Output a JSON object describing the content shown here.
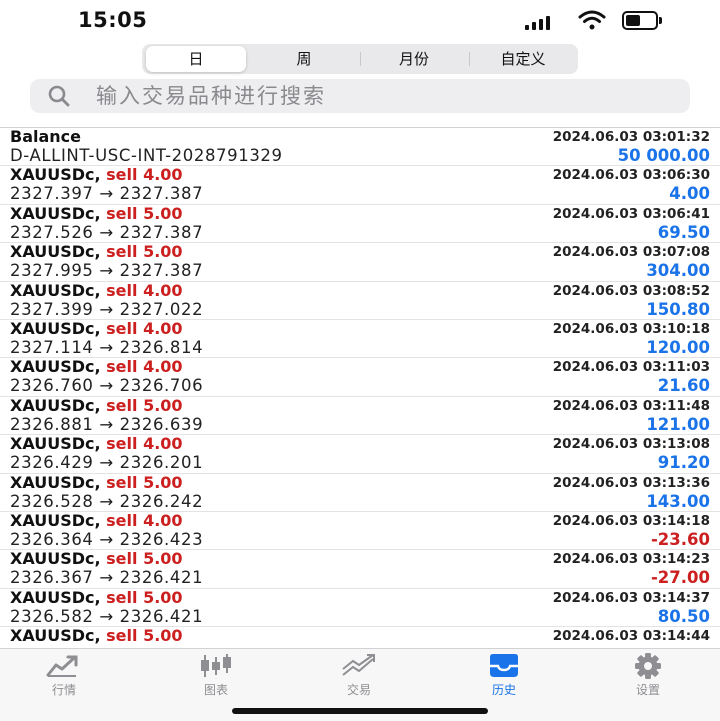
{
  "status_bar": {
    "time": "15:05"
  },
  "segments": [
    {
      "label": "日",
      "active": true
    },
    {
      "label": "周",
      "active": false
    },
    {
      "label": "月份",
      "active": false
    },
    {
      "label": "自定义",
      "active": false
    }
  ],
  "search": {
    "placeholder": "输入交易品种进行搜索"
  },
  "balance_row": {
    "title": "Balance",
    "account": "D-ALLINT-USC-INT-2028791329",
    "time": "2024.06.03 03:01:32",
    "amount": "50 000.00"
  },
  "trades": [
    {
      "symbol": "XAUUSDc,",
      "side": "sell 4.00",
      "prices": "2327.397 → 2327.387",
      "time": "2024.06.03 03:06:30",
      "profit": "4.00",
      "negative": false
    },
    {
      "symbol": "XAUUSDc,",
      "side": "sell 5.00",
      "prices": "2327.526 → 2327.387",
      "time": "2024.06.03 03:06:41",
      "profit": "69.50",
      "negative": false
    },
    {
      "symbol": "XAUUSDc,",
      "side": "sell 5.00",
      "prices": "2327.995 → 2327.387",
      "time": "2024.06.03 03:07:08",
      "profit": "304.00",
      "negative": false
    },
    {
      "symbol": "XAUUSDc,",
      "side": "sell 4.00",
      "prices": "2327.399 → 2327.022",
      "time": "2024.06.03 03:08:52",
      "profit": "150.80",
      "negative": false
    },
    {
      "symbol": "XAUUSDc,",
      "side": "sell 4.00",
      "prices": "2327.114 → 2326.814",
      "time": "2024.06.03 03:10:18",
      "profit": "120.00",
      "negative": false
    },
    {
      "symbol": "XAUUSDc,",
      "side": "sell 4.00",
      "prices": "2326.760 → 2326.706",
      "time": "2024.06.03 03:11:03",
      "profit": "21.60",
      "negative": false
    },
    {
      "symbol": "XAUUSDc,",
      "side": "sell 5.00",
      "prices": "2326.881 → 2326.639",
      "time": "2024.06.03 03:11:48",
      "profit": "121.00",
      "negative": false
    },
    {
      "symbol": "XAUUSDc,",
      "side": "sell 4.00",
      "prices": "2326.429 → 2326.201",
      "time": "2024.06.03 03:13:08",
      "profit": "91.20",
      "negative": false
    },
    {
      "symbol": "XAUUSDc,",
      "side": "sell 5.00",
      "prices": "2326.528 → 2326.242",
      "time": "2024.06.03 03:13:36",
      "profit": "143.00",
      "negative": false
    },
    {
      "symbol": "XAUUSDc,",
      "side": "sell 4.00",
      "prices": "2326.364 → 2326.423",
      "time": "2024.06.03 03:14:18",
      "profit": "-23.60",
      "negative": true
    },
    {
      "symbol": "XAUUSDc,",
      "side": "sell 5.00",
      "prices": "2326.367 → 2326.421",
      "time": "2024.06.03 03:14:23",
      "profit": "-27.00",
      "negative": true
    },
    {
      "symbol": "XAUUSDc,",
      "side": "sell 5.00",
      "prices": "2326.582 → 2326.421",
      "time": "2024.06.03 03:14:37",
      "profit": "80.50",
      "negative": false
    },
    {
      "symbol": "XAUUSDc,",
      "side": "sell 5.00",
      "prices": "",
      "time": "2024.06.03 03:14:44",
      "profit": "",
      "negative": false
    }
  ],
  "tabs": [
    {
      "label": "行情",
      "icon": "quotes-icon",
      "active": false
    },
    {
      "label": "图表",
      "icon": "candlestick-chart-icon",
      "active": false
    },
    {
      "label": "交易",
      "icon": "trade-icon",
      "active": false
    },
    {
      "label": "历史",
      "icon": "history-icon",
      "active": true
    },
    {
      "label": "设置",
      "icon": "gear-icon",
      "active": false
    }
  ],
  "colors": {
    "profit_positive": "#1a73e8",
    "profit_negative": "#cc1f1f",
    "sell": "#cc1f1f",
    "active_tab": "#1a73e8",
    "inactive_tab": "#8e8e93"
  }
}
